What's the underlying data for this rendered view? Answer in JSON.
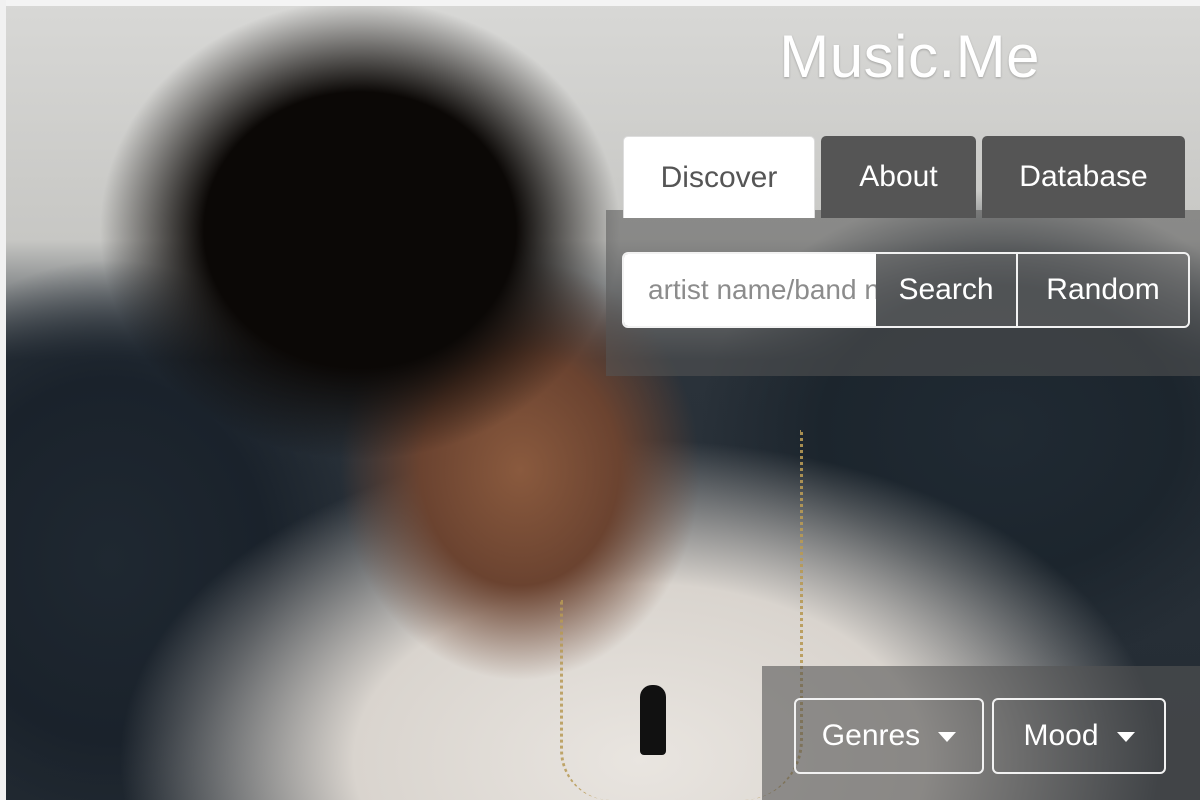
{
  "app": {
    "title": "Music.Me"
  },
  "nav": {
    "tabs": [
      {
        "label": "Discover",
        "active": true
      },
      {
        "label": "About",
        "active": false
      },
      {
        "label": "Database",
        "active": false
      }
    ]
  },
  "search": {
    "placeholder": "artist name/band name",
    "value": "",
    "search_label": "Search",
    "random_label": "Random"
  },
  "filters": {
    "genres_label": "Genres",
    "mood_label": "Mood"
  },
  "colors": {
    "panel": "#555555",
    "active_tab_bg": "#ffffff",
    "active_tab_text": "#555555",
    "text_light": "#ffffff"
  },
  "icons": {
    "dropdown_caret": "caret-down-icon"
  }
}
